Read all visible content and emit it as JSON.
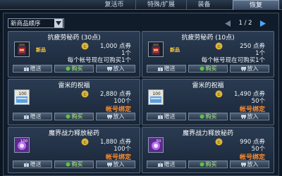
{
  "tabs": [
    {
      "label": "复活币",
      "active": false
    },
    {
      "label": "特殊/扩展",
      "active": false
    },
    {
      "label": "装备",
      "active": false
    },
    {
      "label": "恢复",
      "active": true
    }
  ],
  "sort": {
    "selected": "新商品顺序"
  },
  "pager": {
    "text": "1 / 2"
  },
  "buttons": {
    "gift": "赠送",
    "buy": "购买",
    "add": "放入"
  },
  "items": [
    {
      "title": "抗疲劳秘药 (30点)",
      "icon": "potion-icon",
      "badge": "新品",
      "price": "1,000 点券",
      "count": "1个",
      "note": "每个帐号现在可购买1个"
    },
    {
      "title": "抗疲劳秘药 (10点)",
      "icon": "potion-icon",
      "badge": "新品",
      "price": "250 点券",
      "count": "1个",
      "note": "每个帐号现在可购买1个"
    },
    {
      "title": "雷米的祝福",
      "icon": "scroll-icon",
      "icon_text": "100",
      "price": "2,880 点券",
      "count": "100个",
      "note": "帐号绑定"
    },
    {
      "title": "雷米的祝福",
      "icon": "scroll-icon",
      "icon_text": "100",
      "price": "1,490 点券",
      "count": "50个",
      "note": "帐号绑定"
    },
    {
      "title": "魔界战力释放秘药",
      "icon": "crystal-icon",
      "icon_text": "100",
      "price": "1,880 点券",
      "count": "100个",
      "note": "帐号绑定"
    },
    {
      "title": "魔界战力释放秘药",
      "icon": "crystal-icon",
      "icon_text": "50",
      "price": "990 点券",
      "count": "50个",
      "note": "帐号绑定"
    }
  ],
  "colors": {
    "bound": "#ff8a2a",
    "badge": "#ffcf3a",
    "buy": "#aef08a"
  }
}
